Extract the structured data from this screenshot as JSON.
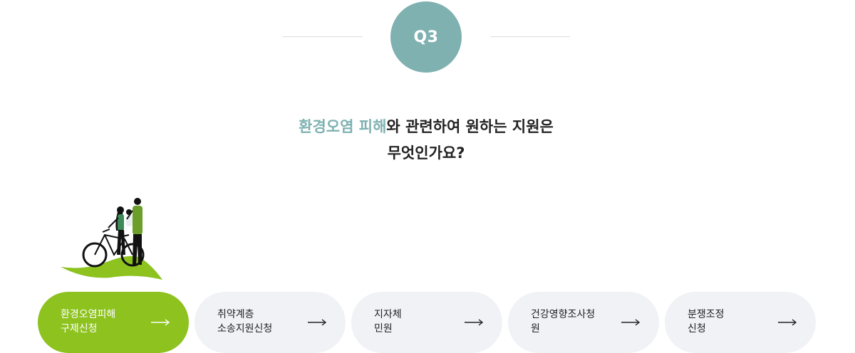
{
  "question_badge": "Q3",
  "question": {
    "highlight": "환경오염 피해",
    "line1_rest": "와 관련하여 원하는 지원은",
    "line2": "무엇인가요?"
  },
  "colors": {
    "accent_teal": "#7fb1b1",
    "accent_green": "#8dc21f",
    "option_bg": "#f1f2f6"
  },
  "options": [
    {
      "line1": "환경오염피해",
      "line2": "구제신청",
      "selected": true,
      "icon": "arrow-right-icon"
    },
    {
      "line1": "취약계층",
      "line2": "소송지원신청",
      "selected": false,
      "icon": "arrow-right-icon"
    },
    {
      "line1": "지자체",
      "line2": "민원",
      "selected": false,
      "icon": "arrow-right-icon"
    },
    {
      "line1": "건강영향조사청",
      "line2": "원",
      "selected": false,
      "icon": "arrow-right-icon"
    },
    {
      "line1": "분쟁조정",
      "line2": "신청",
      "selected": false,
      "icon": "arrow-right-icon"
    }
  ]
}
